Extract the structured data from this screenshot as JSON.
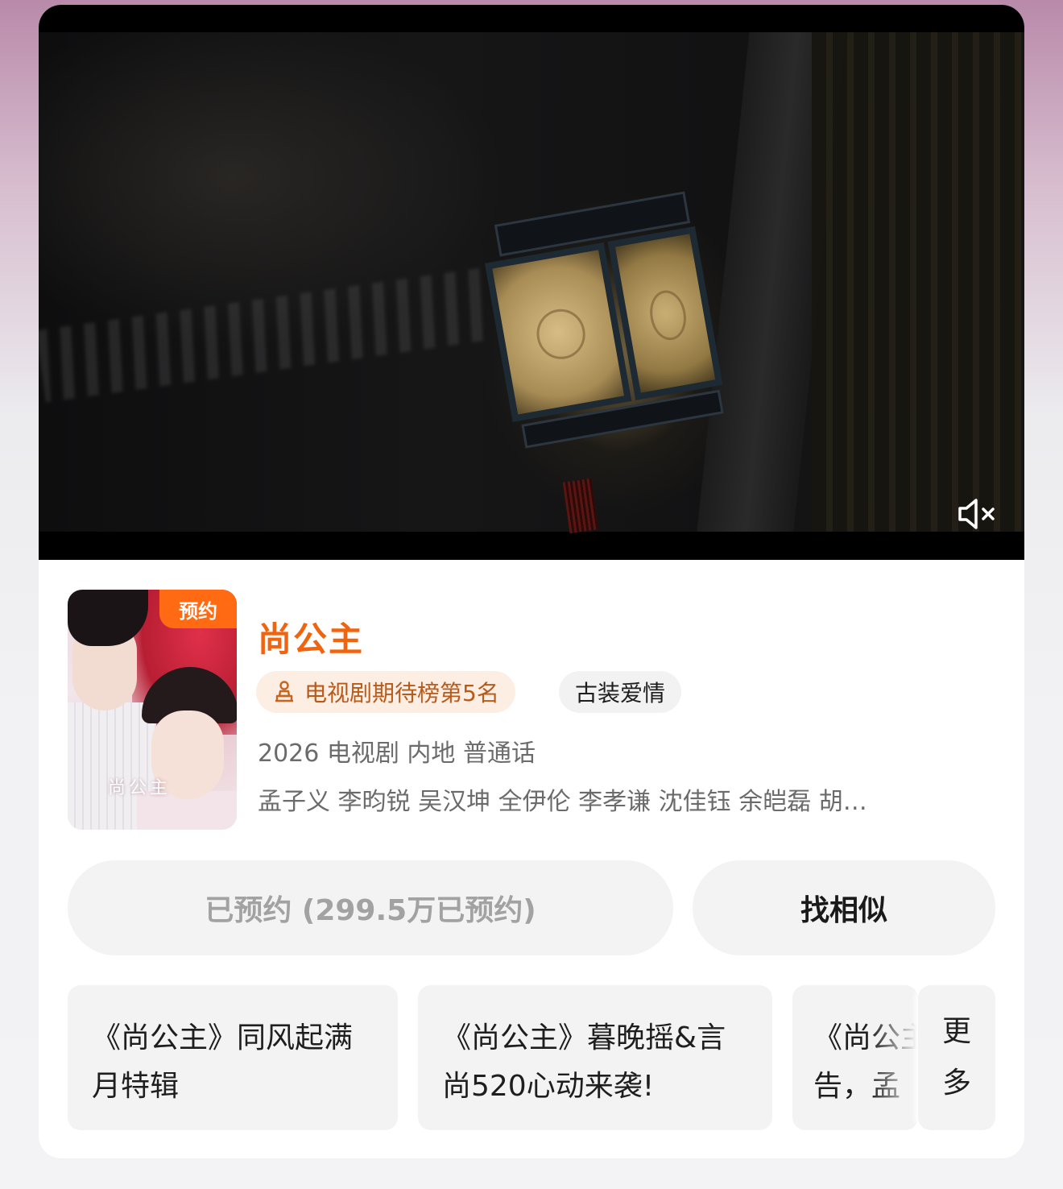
{
  "drama": {
    "title": "尚公主",
    "badge": "预约",
    "poster_title": "尚公主",
    "rank_label": "电视剧期待榜第5名",
    "genre": "古装爱情",
    "meta": "2026 电视剧 内地 普通话",
    "cast": "孟子义 李昀锐 吴汉坤 全伊伦 李孝谦 沈佳钰 余皑磊 胡…"
  },
  "actions": {
    "reserved_label": "已预约 (299.5万已预约)",
    "similar_label": "找相似"
  },
  "features": [
    {
      "line1": "《尚公主》同风起满",
      "line2": "月特辑"
    },
    {
      "line1": "《尚公主》暮晚摇&言",
      "line2": "尚520心动来袭!"
    },
    {
      "line1": "《尚公主",
      "line2": "告，孟"
    }
  ],
  "more": {
    "line1": "更",
    "line2": "多"
  },
  "icons": {
    "mute": "speaker-muted-icon",
    "rank": "trophy-icon"
  },
  "colors": {
    "accent": "#f0630f",
    "badge": "#ff6a13",
    "rank_bg": "#fdeee3",
    "rank_text": "#b85a1a"
  }
}
